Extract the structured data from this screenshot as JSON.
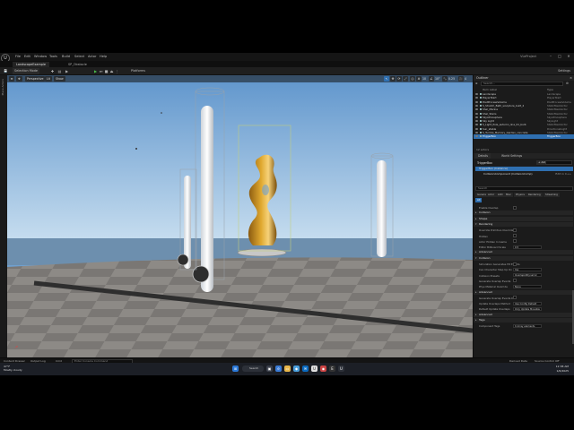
{
  "menubar": {
    "logo": "U",
    "items": [
      "File",
      "Edit",
      "Window",
      "Tools",
      "Build",
      "Select",
      "Actor",
      "Help"
    ],
    "project_name": "VLeProject",
    "controls": [
      "–",
      "□",
      "✕"
    ]
  },
  "tabs": [
    "LandscapeExample",
    "SP_Obstacle"
  ],
  "toolbar": {
    "save_label": "💾",
    "mode_label": "Selection Mode",
    "platforms_label": "Platforms",
    "settings_label": "Settings"
  },
  "left_strip_text": "Place Actors",
  "viewport": {
    "perspective_label": "Perspective",
    "lit_label": "Lit",
    "show_label": "Show",
    "grid_value": "10",
    "angle_value": "10°",
    "scale_value": "0.25",
    "camera_speed": "4",
    "colors": {
      "sky_top": "#5f95cc",
      "sky_bottom": "#c9dff0",
      "sea": "#6d8fae",
      "floor": "#8a8784"
    }
  },
  "outliner": {
    "title": "Outliner",
    "search_placeholder": "Search...",
    "col_label": "Item Label",
    "col_type": "Type",
    "rows": [
      {
        "name": "Landscape",
        "type": "Landscape"
      },
      {
        "name": "PlayerStart",
        "type": "PlayerStart"
      },
      {
        "name": "PostProcessVolume",
        "type": "PostProcessVolume"
      },
      {
        "name": "S_Stretch_Bath_sculpture_built_2",
        "type": "StaticMeshActor"
      },
      {
        "name": "Shel_Marina",
        "type": "StaticMeshActor"
      },
      {
        "name": "Shel_Stairs",
        "type": "StaticMeshActor"
      },
      {
        "name": "SkyAtmosphere",
        "type": "SkyAtmosphere"
      },
      {
        "name": "Sky Light",
        "type": "SkyLight"
      },
      {
        "name": "S_Light_Pole_autumn_line_01_bulb",
        "type": "StaticMeshActor"
      },
      {
        "name": "Sun_stable",
        "type": "DirectionalLight"
      },
      {
        "name": "S_Tumba_Memory_Garden_concrete",
        "type": "StaticMeshActor"
      },
      {
        "name": "TriggerBox",
        "type": "TriggerBox"
      }
    ],
    "footer": "12 actors"
  },
  "details": {
    "tab_details": "Details",
    "tab_world": "World Settings",
    "actor_name": "TriggerBox",
    "add_label": "+ Add",
    "components": [
      {
        "name": "TriggerBox (Instance)",
        "extra": ""
      },
      {
        "name": "CollisionComponent (CollisionComp)",
        "extra": "Edit in C++"
      }
    ],
    "search_placeholder": "Search",
    "filters": [
      "General",
      "Actor",
      "LOD",
      "Misc",
      "Physics",
      "Rendering",
      "Streaming",
      "All"
    ],
    "sections": [
      {
        "label": "Enable Overlap",
        "type": "prop"
      },
      {
        "label": "Collision",
        "type": "cat"
      },
      {
        "label": "Shape",
        "type": "cat"
      },
      {
        "label": "Rendering",
        "type": "cat-open"
      },
      {
        "label": "Override Primitive Override",
        "type": "prop"
      },
      {
        "label": "Hidden",
        "type": "prop"
      },
      {
        "label": "Actor Hidden In Game",
        "type": "prop"
      },
      {
        "label": "Editor Billboard Scale",
        "type": "prop"
      },
      {
        "label": "Advanced",
        "type": "cat"
      },
      {
        "label": "Collision",
        "type": "cat-open"
      },
      {
        "label": "Simulation Generates Hit Events",
        "type": "prop"
      },
      {
        "label": "Can Character Step Up On",
        "type": "prop"
      },
      {
        "label": "Collision Presets",
        "type": "prop"
      },
      {
        "label": "Generate Overlap Events",
        "type": "prop"
      },
      {
        "label": "Phys Material Override",
        "type": "prop"
      },
      {
        "label": "Advanced",
        "type": "cat"
      },
      {
        "label": "Generate Overlap Events D",
        "type": "prop"
      },
      {
        "label": "Update Overlaps Method",
        "type": "prop"
      },
      {
        "label": "Default Update Overlaps",
        "type": "prop"
      },
      {
        "label": "Advanced",
        "type": "cat"
      },
      {
        "label": "Tags",
        "type": "cat"
      },
      {
        "label": "Component Tags",
        "type": "prop"
      }
    ],
    "values": {
      "override": "Debug settings",
      "scale": "0.5",
      "can_step": "Yes",
      "presets": "OverlapAllDynamic",
      "phys_mat": "None",
      "update_method": "Use Config Default",
      "default_update": "Only Update Movable",
      "tags": "0 Array elements"
    }
  },
  "statusbar": {
    "content_drawer": "Content Drawer",
    "output_log": "Output Log",
    "cmd": "Cmd",
    "cmd_placeholder": "Enter Console Command",
    "derived_data": "Derived Data",
    "source_control": "Source Control Off"
  },
  "taskbar": {
    "weather_temp": "47°F",
    "weather_desc": "Mostly cloudy",
    "search_label": "Search",
    "time": "12:38 AM",
    "date": "1/6/2025"
  }
}
